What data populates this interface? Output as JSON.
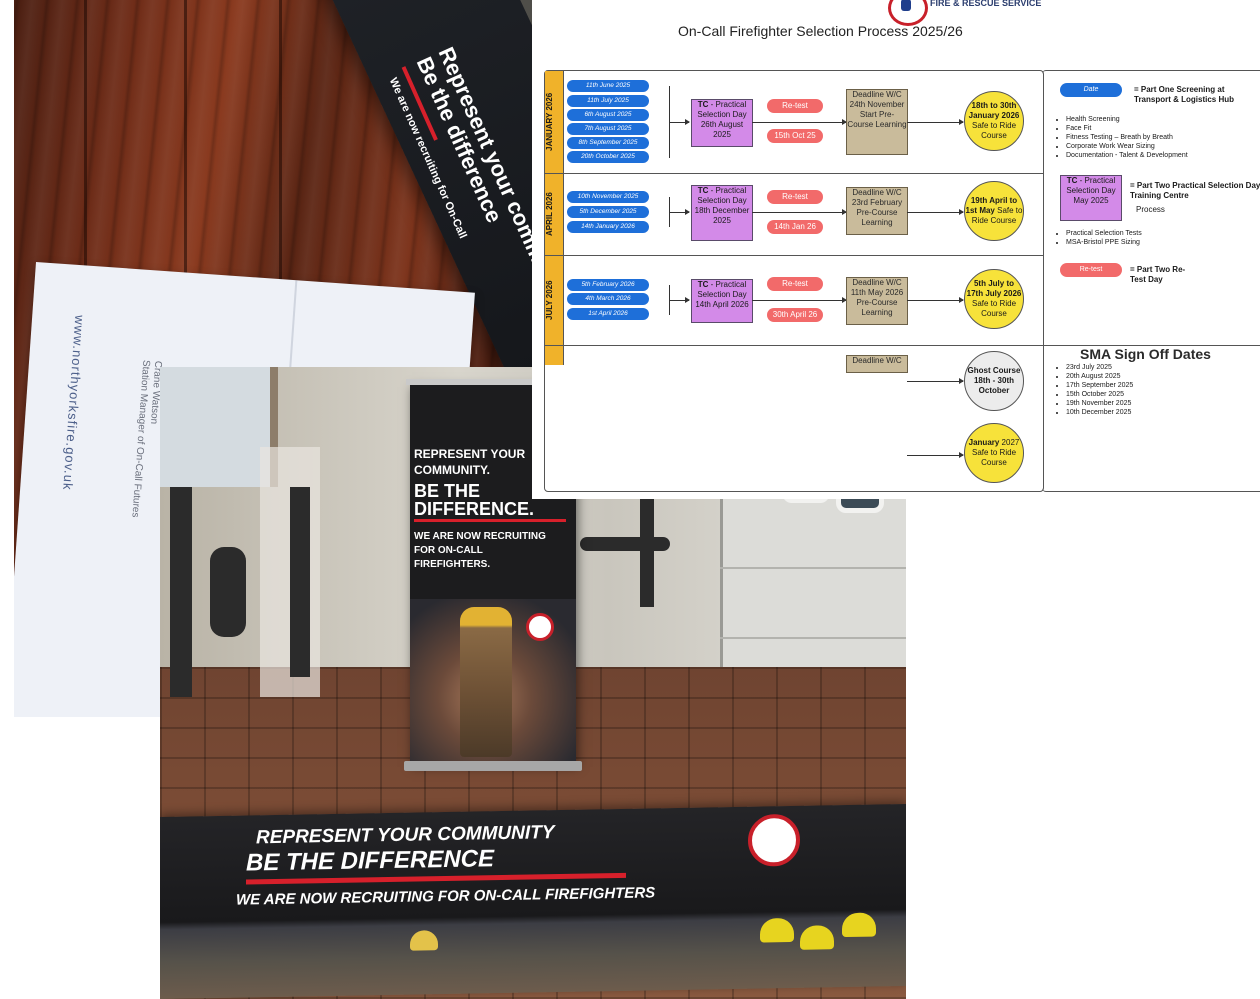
{
  "leaflet": {
    "line1": "Represent your community",
    "line2": "Be the difference",
    "line3": "We are now recruiting for On-Call",
    "letter_url": "www.northyorksfire.gov.uk",
    "letter_name": "Crane Watson",
    "letter_role": "Station Manager of On-Call Futures"
  },
  "rollup": {
    "line1": "REPRESENT YOUR",
    "line2": "COMMUNITY.",
    "line3": "BE THE",
    "line4": "DIFFERENCE.",
    "line5": "WE ARE NOW RECRUITING",
    "line6": "FOR ON-CALL",
    "line7": "FIREFIGHTERS."
  },
  "banner": {
    "line1": "REPRESENT YOUR COMMUNITY",
    "line2": "BE THE DIFFERENCE",
    "line3": "WE ARE NOW RECRUITING FOR ON-CALL FIREFIGHTERS"
  },
  "doc": {
    "org": "FIRE & RESCUE SERVICE",
    "title": "On-Call Firefighter Selection Process 2025/26",
    "rows": [
      {
        "tab": "JANUARY 2026",
        "dates": [
          "11th June 2025",
          "11th July 2025",
          "6th August 2025",
          "7th August 2025",
          "8th September 2025",
          "20th October 2025"
        ],
        "tc": [
          "TC",
          " - Practical Selection Day 26th August 2025"
        ],
        "retest": "Re-test",
        "retest_date": "15th Oct 25",
        "deadline": "Deadline W/C 24th November Start Pre-Course Learning",
        "course_bold": "18th to 30th January 2026",
        "course_rest": " Safe to Ride Course"
      },
      {
        "tab": "APRIL 2026",
        "dates": [
          "10th November 2025",
          "5th December 2025",
          "14th January 2026"
        ],
        "tc": [
          "TC",
          " - Practical Selection Day 18th December 2025"
        ],
        "retest": "Re-test",
        "retest_date": "14th Jan 26",
        "deadline": "Deadline W/C 23rd February Pre-Course Learning",
        "course_bold": "19th April to 1st May",
        "course_rest": " Safe to Ride Course"
      },
      {
        "tab": "JULY 2026",
        "dates": [
          "5th February 2026",
          "4th March 2026",
          "1st April 2026"
        ],
        "tc": [
          "TC",
          " - Practical Selection Day 14th April 2026"
        ],
        "retest": "Re-test",
        "retest_date": "30th April 26",
        "deadline": "Deadline W/C 11th May 2026 Pre-Course Learning",
        "course_bold": "5th July to 17th July 2026",
        "course_rest": " Safe to Ride Course"
      },
      {
        "deadline_partial": "Deadline W/C",
        "ghost_bold": "Ghost Course 18th - 30th October",
        "jan_bold": "January",
        "jan_rest": " 2027 Safe to Ride Course"
      }
    ],
    "legend": {
      "date_pill": "Date",
      "date_text": "= Part One Screening at Transport & Logistics Hub",
      "screening_items": [
        "Health Screening",
        "Face Fit",
        "Fitness Testing – Breath by Breath",
        "Corporate Work Wear Sizing",
        "Documentation - Talent & Development"
      ],
      "tc_pill_bold": "TC",
      "tc_pill_rest": " - Practical Selection Day May 2025",
      "tc_text": "= Part Two Practical Selection Day - Training Centre",
      "tc_process": "Process",
      "practical_items": [
        "Practical Selection Tests",
        "MSA-Bristol PPE Sizing"
      ],
      "retest_pill": "Re-test",
      "retest_text": "= Part Two Re-Test Day"
    },
    "sma": {
      "title": "SMA Sign Off Dates",
      "dates": [
        "23rd July 2025",
        "20th August 2025",
        "17th September 2025",
        "15th October 2025",
        "19th November 2025",
        "10th December 2025"
      ]
    }
  },
  "colors": {
    "date_pill": "#1e6fd9",
    "tc_box": "#d38ae8",
    "retest": "#f26a6a",
    "deadline": "#c9bb9b",
    "course": "#f7e23a",
    "tab": "#f0b22a",
    "brand_red": "#d7202b"
  }
}
